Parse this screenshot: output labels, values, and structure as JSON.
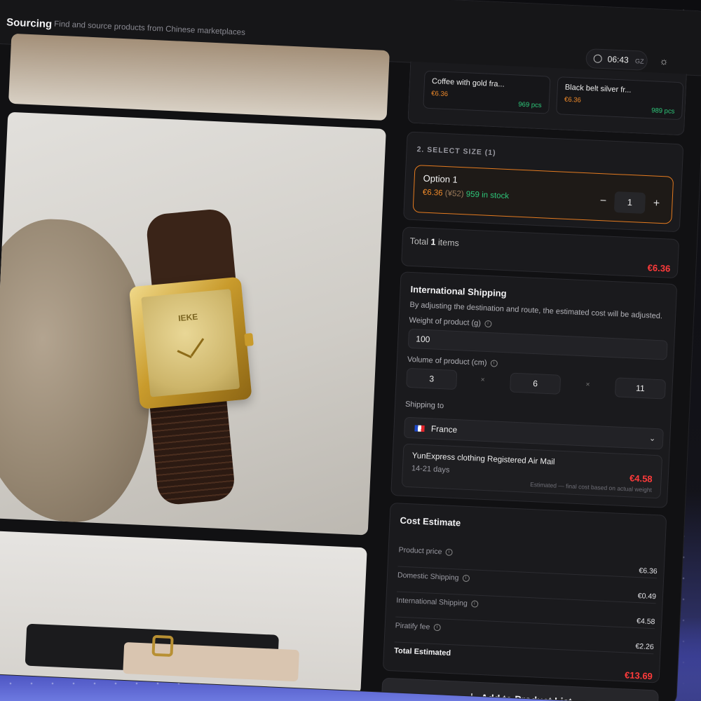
{
  "header": {
    "title": "Sourcing",
    "subtitle": "Find and source products from Chinese marketplaces",
    "time": "06:43",
    "timezone": "GZ"
  },
  "variants": [
    {
      "name": "Coffee with gold fra...",
      "price": "€6.36",
      "stock": "969 pcs"
    },
    {
      "name": "Black belt silver fr...",
      "price": "€6.36",
      "stock": "989 pcs"
    }
  ],
  "size_section": {
    "title": "2. SELECT SIZE (1)",
    "option": {
      "name": "Option 1",
      "price": "€6.36",
      "price_cny": "(¥52)",
      "stock": "959 in stock",
      "quantity": "1",
      "minus": "−",
      "plus": "+"
    }
  },
  "total": {
    "label_prefix": "Total",
    "count": "1",
    "label_suffix": "items",
    "value": "€6.36"
  },
  "shipping": {
    "title": "International Shipping",
    "description": "By adjusting the destination and route, the estimated cost will be adjusted.",
    "weight_label": "Weight of product (g)",
    "weight_value": "100",
    "volume_label": "Volume of product (cm)",
    "volume": [
      "3",
      "6",
      "11"
    ],
    "times_symbol": "×",
    "ship_to_label": "Shipping to",
    "destination": "France",
    "route": {
      "name": "YunExpress clothing Registered Air Mail",
      "days": "14-21 days",
      "price": "€4.58",
      "note": "Estimated — final cost based on actual weight"
    }
  },
  "cost": {
    "title": "Cost Estimate",
    "rows": [
      {
        "label": "Product price",
        "value": "€6.36"
      },
      {
        "label": "Domestic Shipping",
        "value": "€0.49"
      },
      {
        "label": "International Shipping",
        "value": "€4.58"
      },
      {
        "label": "Piratify fee",
        "value": "€2.26"
      }
    ],
    "total_label": "Total Estimated",
    "total_value": "€13.69"
  },
  "add_button": {
    "label": "Add to Product List"
  },
  "gallery": {
    "watch_brand": "IEKE"
  },
  "colors": {
    "accent_orange": "#e47b20",
    "price_red": "#ff3b3b",
    "stock_green": "#2ec77a",
    "background": "#111113"
  },
  "icons": [
    "clock-icon",
    "sun-icon",
    "info-icon",
    "chevron-down-icon",
    "plus-icon",
    "flag-france-icon"
  ]
}
